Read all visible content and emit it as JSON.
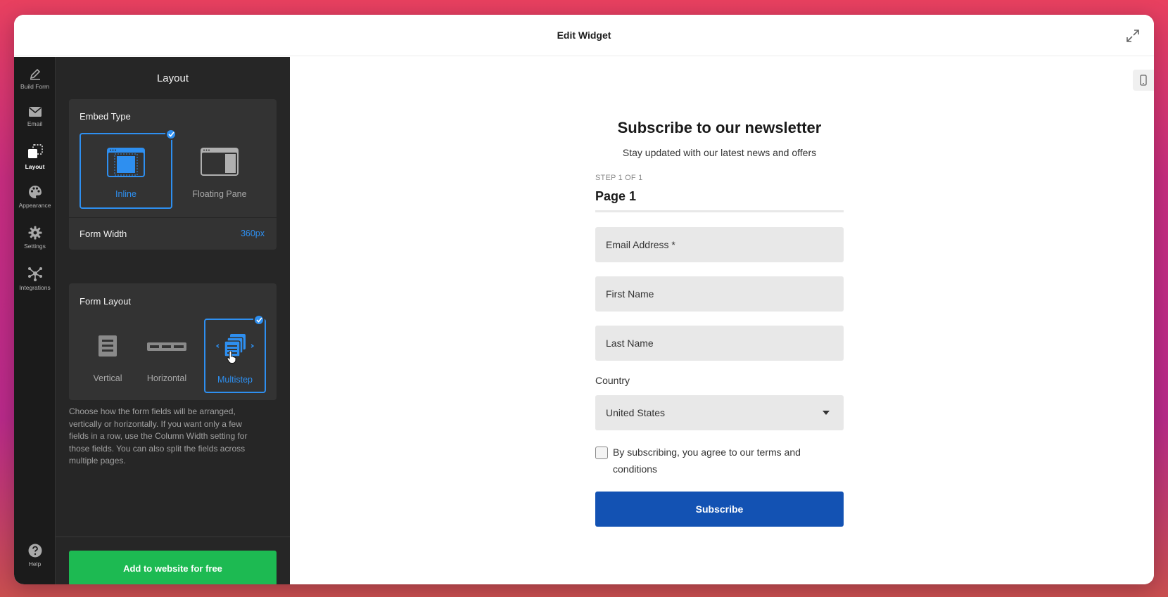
{
  "window": {
    "title": "Edit Widget"
  },
  "rail": {
    "items": [
      {
        "label": "Build Form",
        "icon": "pencil-icon"
      },
      {
        "label": "Email",
        "icon": "envelope-icon"
      },
      {
        "label": "Layout",
        "icon": "layout-icon",
        "active": true
      },
      {
        "label": "Appearance",
        "icon": "palette-icon"
      },
      {
        "label": "Settings",
        "icon": "gear-icon"
      },
      {
        "label": "Integrations",
        "icon": "network-icon"
      }
    ],
    "help": {
      "label": "Help",
      "icon": "question-icon"
    }
  },
  "panel": {
    "title": "Layout",
    "embed_type": {
      "heading": "Embed Type",
      "options": [
        {
          "label": "Inline",
          "selected": true
        },
        {
          "label": "Floating Pane",
          "selected": false
        }
      ],
      "form_width_label": "Form Width",
      "form_width_value": "360px"
    },
    "form_layout": {
      "heading": "Form Layout",
      "options": [
        {
          "label": "Vertical",
          "selected": false
        },
        {
          "label": "Horizontal",
          "selected": false
        },
        {
          "label": "Multistep",
          "selected": true
        }
      ]
    },
    "help_text": "Choose how the form fields will be arranged, vertically or horizontally. If you want only a few fields in a row, use the Column Width setting for those fields. You can also split the fields across multiple pages.",
    "add_button": "Add to website for free"
  },
  "preview": {
    "title": "Subscribe to our newsletter",
    "subtitle": "Stay updated with our latest news and offers",
    "step": "STEP 1 OF 1",
    "page_name": "Page 1",
    "fields": {
      "email": "Email Address *",
      "first_name": "First Name",
      "last_name": "Last Name"
    },
    "country_label": "Country",
    "country_value": "United States",
    "consent": "By subscribing, you agree to our terms and conditions",
    "subscribe": "Subscribe"
  },
  "colors": {
    "accent_blue": "#2e8ff0",
    "green": "#1dba52",
    "subscribe_blue": "#1352b3",
    "panel_bg": "#262626",
    "rail_bg": "#1b1b1b"
  }
}
